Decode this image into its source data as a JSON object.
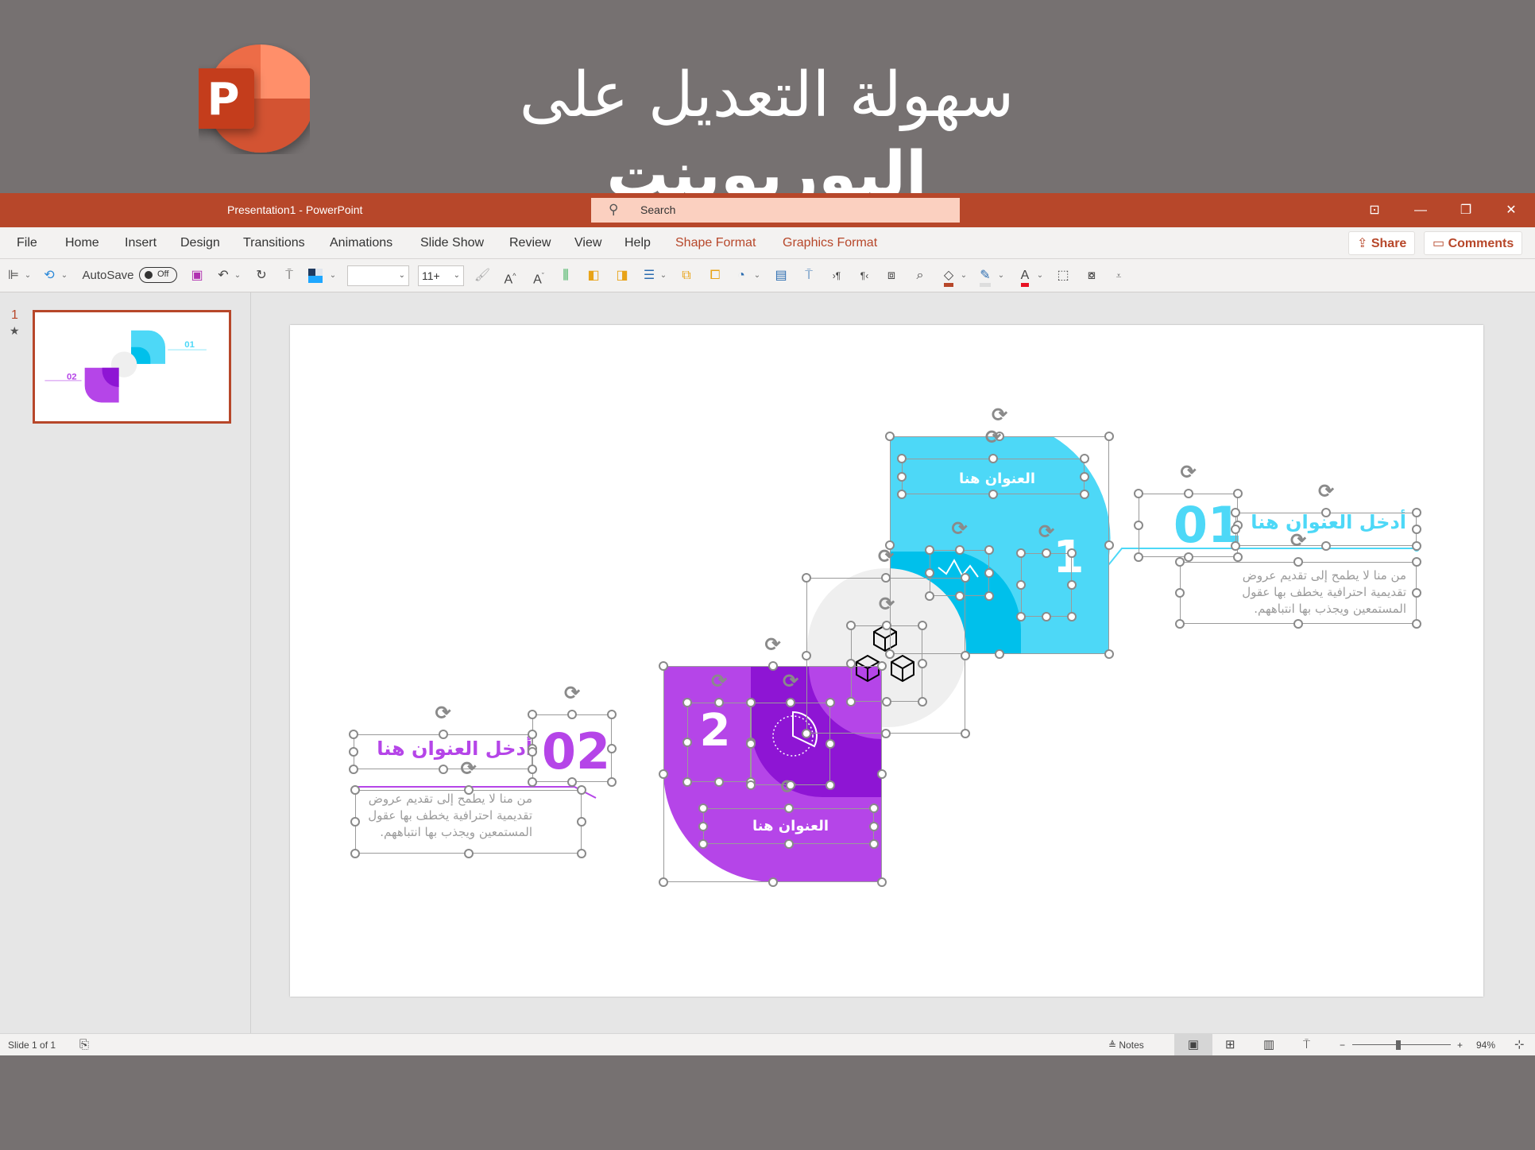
{
  "hero": {
    "title_regular": "سهولة التعديل على",
    "title_bold": "البوربوينت",
    "logo_letter": "P"
  },
  "titlebar": {
    "document_title": "Presentation1  -  PowerPoint",
    "search_placeholder": "Search",
    "buttons": {
      "ribbon_display": "⊡",
      "minimize": "—",
      "restore": "❐",
      "close": "✕"
    }
  },
  "ribbon": {
    "tabs": [
      {
        "label": "File"
      },
      {
        "label": "Home"
      },
      {
        "label": "Insert"
      },
      {
        "label": "Design"
      },
      {
        "label": "Transitions"
      },
      {
        "label": "Animations"
      },
      {
        "label": "Slide Show"
      },
      {
        "label": "Review"
      },
      {
        "label": "View"
      },
      {
        "label": "Help"
      }
    ],
    "contextual_tabs": [
      {
        "label": "Shape Format"
      },
      {
        "label": "Graphics Format"
      }
    ],
    "share_label": "Share",
    "comments_label": "Comments"
  },
  "toolbar": {
    "autosave_label": "AutoSave",
    "autosave_state": "Off",
    "font_name": "",
    "font_size": "11+",
    "icons": [
      "align-icon",
      "rotate-icon",
      "save-icon",
      "undo-icon",
      "redo-icon",
      "present-icon",
      "color-scheme-icon",
      "format-painter-icon",
      "increase-font-icon",
      "decrease-font-icon",
      "align-text-icon",
      "bring-forward-icon",
      "send-backward-icon",
      "bullets-icon",
      "duplicate-icon",
      "group-icon",
      "shapes-icon",
      "text-box-icon",
      "slide-show-icon",
      "ltr-icon",
      "rtl-icon",
      "reuse-slides-icon",
      "find-icon",
      "fill-color-icon",
      "outline-color-icon",
      "font-color-icon",
      "select-icon",
      "arrange-icon",
      "customize-icon"
    ],
    "fill_color": "#B7472A",
    "font_color": "#E81123"
  },
  "thumbnails": [
    {
      "number": "1",
      "star": "★"
    }
  ],
  "slide": {
    "step1": {
      "number_big": "01",
      "number_small": "1",
      "heading": "أدخل العنوان هنا",
      "shape_title": "العنوان هنا",
      "body": "من منا لا يطمح إلى تقديم عروض تقديمية احترافية يخطف بها عقول المستمعين ويجذب بها انتباههم.",
      "color": "#4DD8F7",
      "dark_color": "#00C0EB"
    },
    "step2": {
      "number_big": "02",
      "number_small": "2",
      "heading": "أدخل العنوان هنا",
      "shape_title": "العنوان هنا",
      "body": "من منا لا يطمح إلى تقديم عروض تقديمية احترافية يخطف بها عقول المستمعين ويجذب بها انتباههم.",
      "color": "#B545E8",
      "dark_color": "#8E15D4"
    },
    "center_icon": "cubes-icon",
    "text_gray": "#9B9B9B"
  },
  "statusbar": {
    "slide_info": "Slide 1 of 1",
    "notes_label": "Notes",
    "zoom_level": "94%",
    "zoom_fraction": 0.47
  }
}
